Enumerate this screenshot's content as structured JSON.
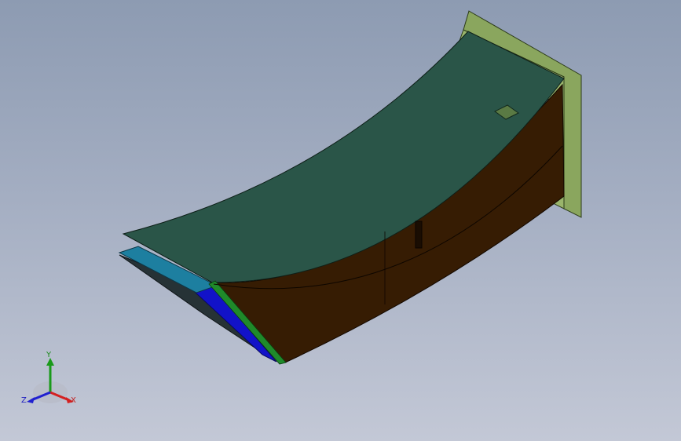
{
  "colors": {
    "background_top": "#8d9bb2",
    "background_bottom": "#c3c8d6",
    "top_face": "#2a5548",
    "side_face": "#361c03",
    "flange": "#8aa65e",
    "inner_blue": "#1212c8",
    "cyan_face": "#1d7fa0",
    "green_edge": "#1f8a2a",
    "axis_x": "#d42020",
    "axis_y": "#1a9a1a",
    "axis_z": "#2020d0"
  },
  "triad": {
    "x_label": "X",
    "y_label": "Y",
    "z_label": "Z"
  }
}
